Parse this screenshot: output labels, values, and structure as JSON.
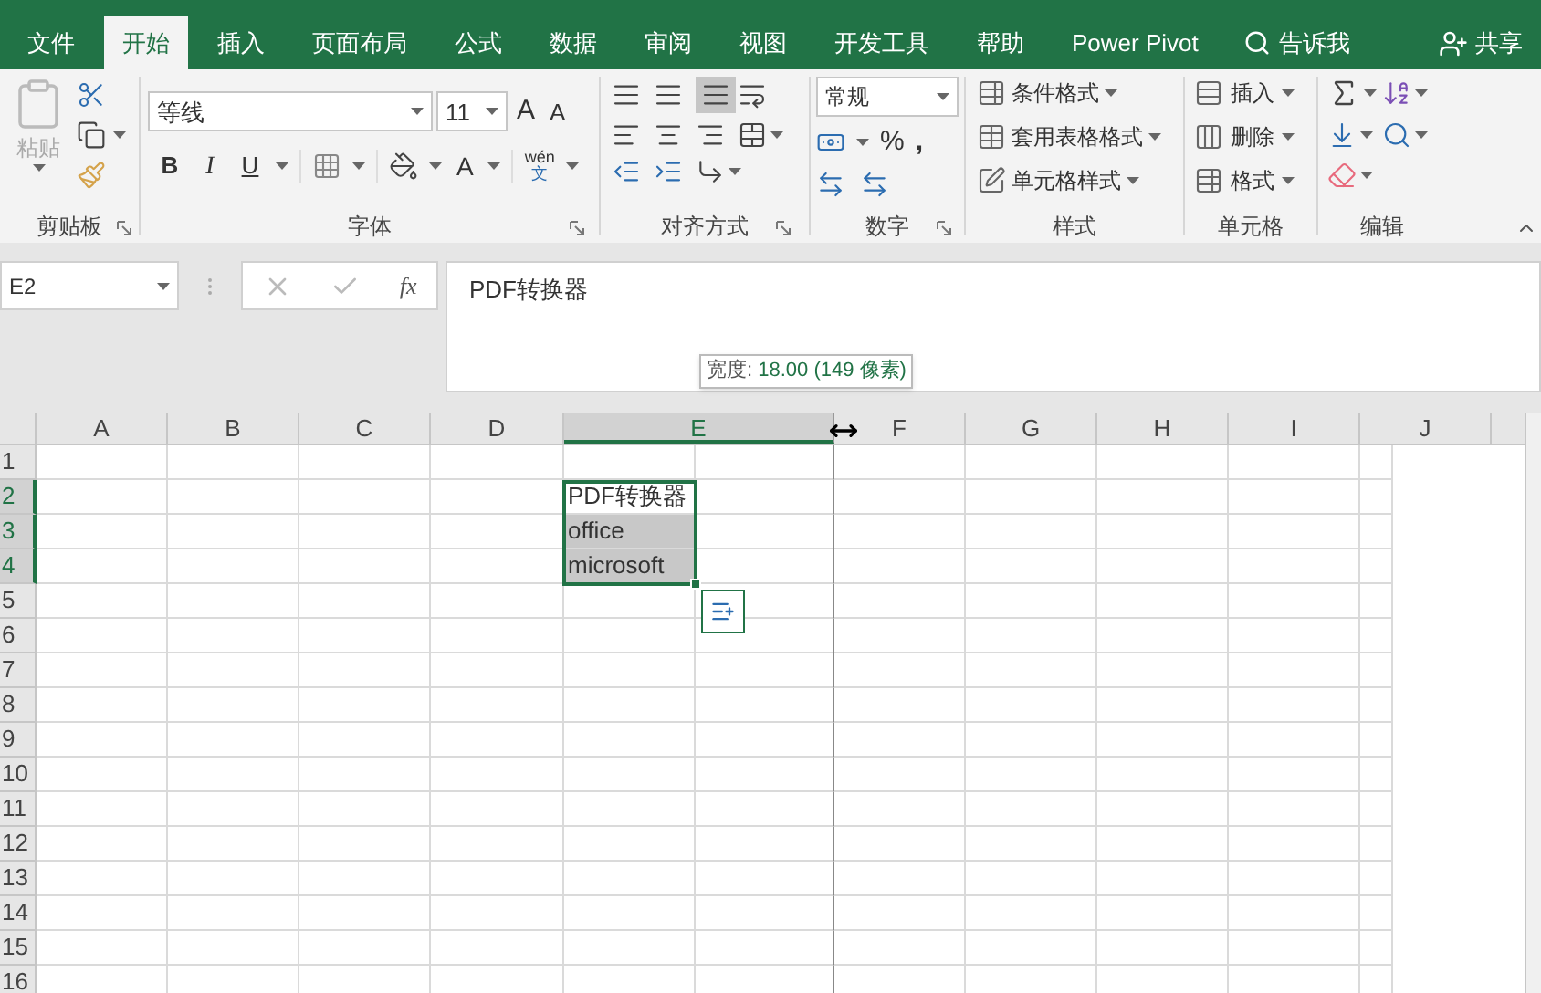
{
  "tabs": [
    {
      "label": "文件",
      "selected": false
    },
    {
      "label": "开始",
      "selected": true
    },
    {
      "label": "插入",
      "selected": false
    },
    {
      "label": "页面布局",
      "selected": false
    },
    {
      "label": "公式",
      "selected": false
    },
    {
      "label": "数据",
      "selected": false
    },
    {
      "label": "审阅",
      "selected": false
    },
    {
      "label": "视图",
      "selected": false
    },
    {
      "label": "开发工具",
      "selected": false
    },
    {
      "label": "帮助",
      "selected": false
    },
    {
      "label": "Power Pivot",
      "selected": false
    }
  ],
  "tell_me": "告诉我",
  "share": "共享",
  "clipboard": {
    "paste": "粘贴",
    "label": "剪贴板"
  },
  "font": {
    "name": "等线",
    "size": "11",
    "grow": "A",
    "shrink": "A",
    "bold": "B",
    "italic": "I",
    "underline": "U",
    "font_color": "A",
    "phonetic_top": "wén",
    "phonetic_bottom": "文",
    "label": "字体"
  },
  "alignment": {
    "label": "对齐方式"
  },
  "number": {
    "format": "常规",
    "percent": "%",
    "comma": ",",
    "label": "数字"
  },
  "styles": {
    "items": [
      "条件格式",
      "套用表格格式",
      "单元格样式"
    ],
    "label": "样式"
  },
  "cells": {
    "items": [
      "插入",
      "删除",
      "格式"
    ],
    "label": "单元格"
  },
  "editing": {
    "label": "编辑"
  },
  "name_box": "E2",
  "function_button": "fx",
  "formula": "PDF转换器",
  "tooltip": {
    "label": "宽度:",
    "value": "18.00 (149 像素)"
  },
  "columns": [
    {
      "label": "A",
      "selected": false
    },
    {
      "label": "B",
      "selected": false
    },
    {
      "label": "C",
      "selected": false
    },
    {
      "label": "D",
      "selected": false
    },
    {
      "label": "E",
      "selected": true
    },
    {
      "label": "F",
      "selected": false
    },
    {
      "label": "G",
      "selected": false
    },
    {
      "label": "H",
      "selected": false
    },
    {
      "label": "I",
      "selected": false
    },
    {
      "label": "J",
      "selected": false
    }
  ],
  "rows": [
    {
      "label": "1",
      "selected": false
    },
    {
      "label": "2",
      "selected": true,
      "cell_e": {
        "text": "PDF转换器",
        "active": true
      }
    },
    {
      "label": "3",
      "selected": true,
      "cell_e": {
        "text": "office",
        "active": false
      }
    },
    {
      "label": "4",
      "selected": true,
      "cell_e": {
        "text": "microsoft",
        "active": false
      }
    },
    {
      "label": "5",
      "selected": false
    },
    {
      "label": "6",
      "selected": false
    },
    {
      "label": "7",
      "selected": false
    },
    {
      "label": "8",
      "selected": false
    },
    {
      "label": "9",
      "selected": false
    },
    {
      "label": "10",
      "selected": false
    },
    {
      "label": "11",
      "selected": false
    },
    {
      "label": "12",
      "selected": false
    },
    {
      "label": "13",
      "selected": false
    },
    {
      "label": "14",
      "selected": false
    },
    {
      "label": "15",
      "selected": false
    },
    {
      "label": "16",
      "selected": false
    }
  ]
}
